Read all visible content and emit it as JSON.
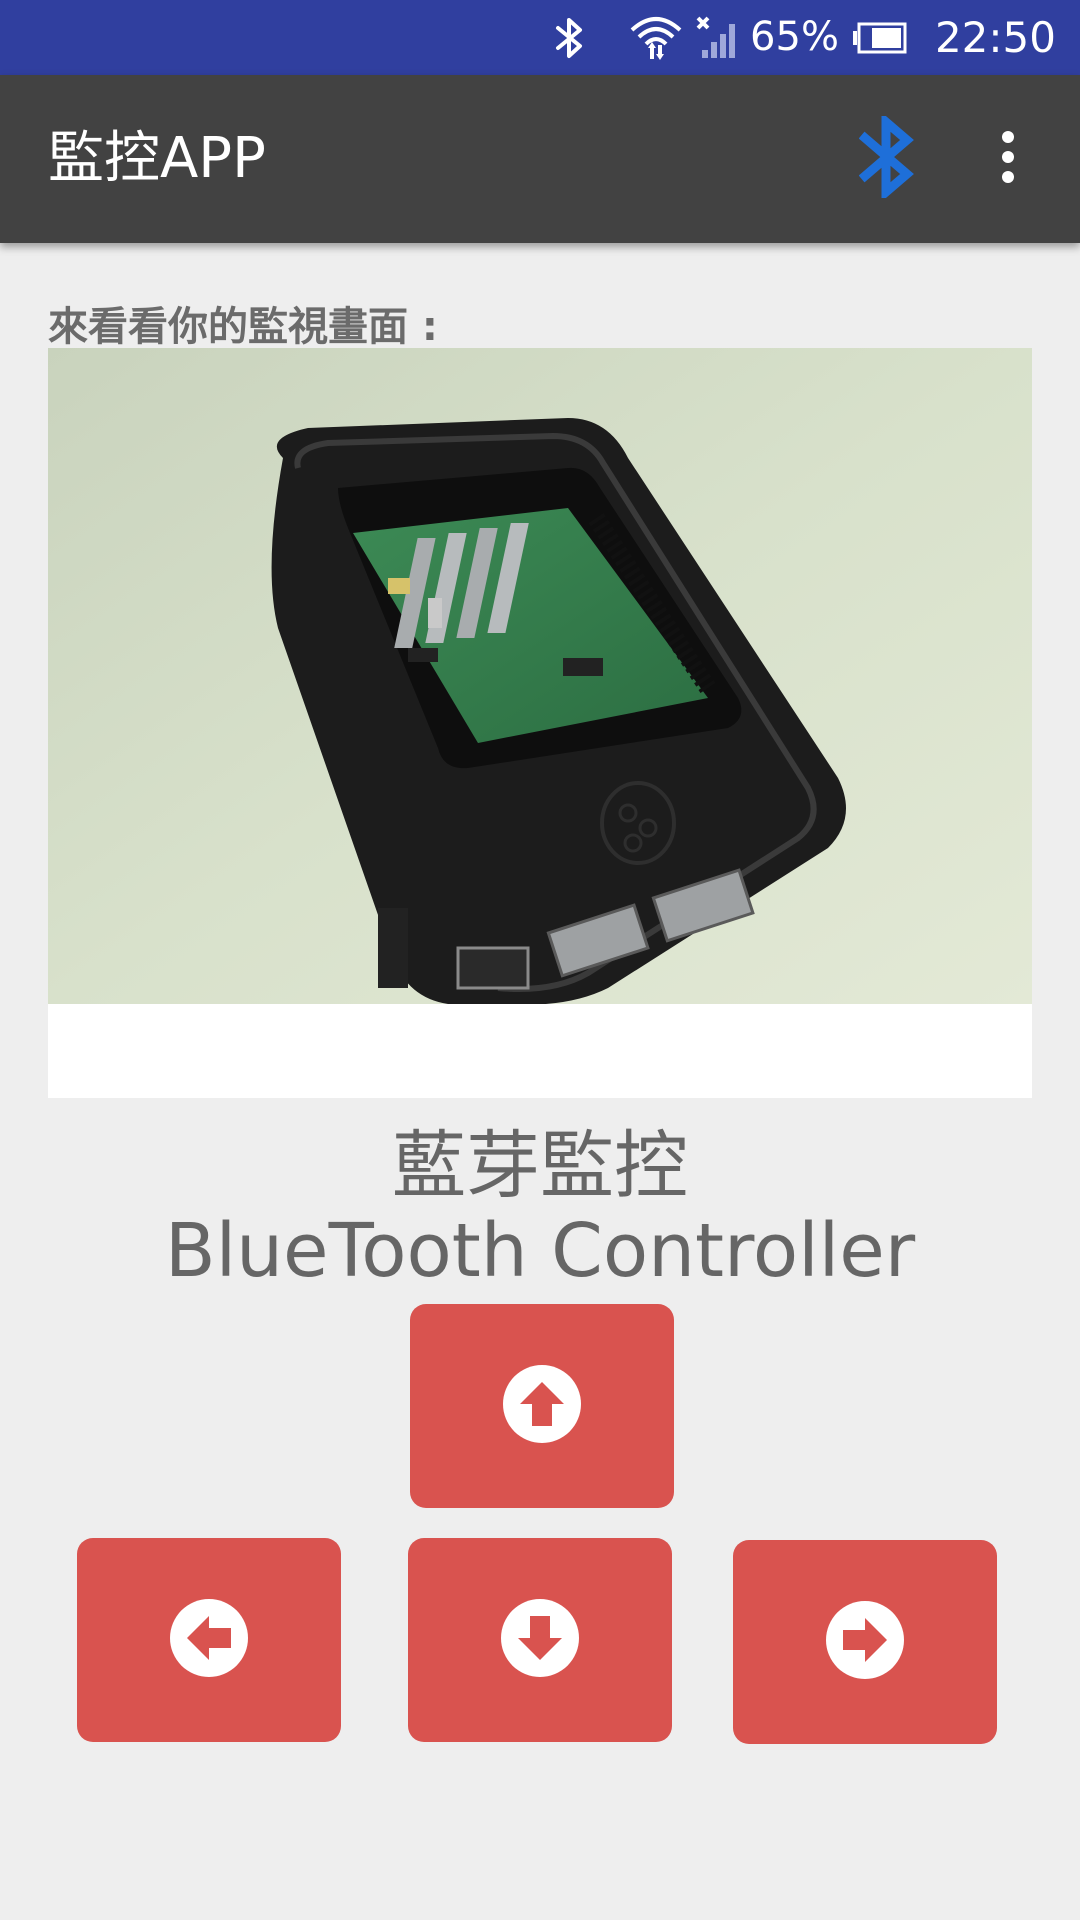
{
  "status_bar": {
    "battery_percent": "65%",
    "time": "22:50",
    "icons": [
      "bluetooth-icon",
      "wifi-icon",
      "signal-icon",
      "battery-icon"
    ]
  },
  "app_bar": {
    "title": "監控APP",
    "actions": [
      "bluetooth-icon",
      "more-vert-icon"
    ]
  },
  "content": {
    "monitor_label": "來看看你的監視畫面 :",
    "title_cn": "藍芽監控",
    "title_en": "BlueTooth Controller",
    "controls": [
      "arrow-up-circle-icon",
      "arrow-left-circle-icon",
      "arrow-down-circle-icon",
      "arrow-right-circle-icon"
    ]
  },
  "colors": {
    "status_bar": "#303f9f",
    "app_bar": "#424242",
    "background": "#eeeeee",
    "button": "#d9534f",
    "bluetooth_accent": "#1e6fd9",
    "text_gray": "#666666"
  }
}
